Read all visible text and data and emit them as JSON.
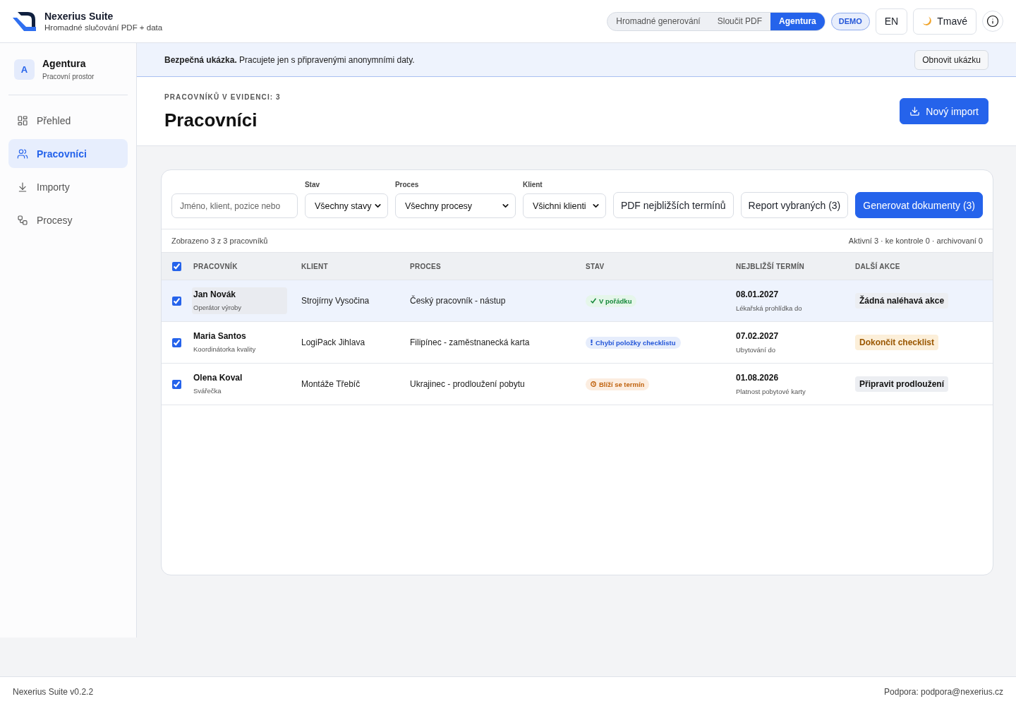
{
  "header": {
    "app_name": "Nexerius Suite",
    "tagline": "Hromadné slučování PDF + data",
    "modes": [
      {
        "label": "Hromadné generování",
        "selected": false
      },
      {
        "label": "Sloučit PDF",
        "selected": false
      },
      {
        "label": "Agentura",
        "selected": true
      }
    ],
    "badge": "DEMO",
    "language_button": "EN",
    "theme_button": "Tmavé"
  },
  "sidebar": {
    "workspace": {
      "initial": "A",
      "name": "Agentura",
      "subtitle": "Pracovní prostor"
    },
    "items": [
      {
        "label": "Přehled",
        "selected": false
      },
      {
        "label": "Pracovníci",
        "selected": true
      },
      {
        "label": "Importy",
        "selected": false
      },
      {
        "label": "Procesy",
        "selected": false
      }
    ]
  },
  "banner": {
    "text": "**Bezpečná ukázka.** Pracujete jen s připravenými anonymními daty.",
    "button": "Obnovit ukázku"
  },
  "page": {
    "eyebrow": "PRACOVNÍKŮ V EVIDENCI: 3",
    "title": "Pracovníci",
    "primary_button": "Nový import"
  },
  "filters": {
    "search": {
      "placeholder": "Jméno, klient, pozice nebo"
    },
    "selects": [
      {
        "label": "Stav",
        "value": "Všechny stavy"
      },
      {
        "label": "Proces",
        "value": "Všechny procesy"
      },
      {
        "label": "Klient",
        "value": "Všichni klienti"
      }
    ],
    "buttons": [
      {
        "label": "PDF nejbližších termínů",
        "kind": "secondary"
      },
      {
        "label": "Report vybraných (3)",
        "kind": "secondary"
      },
      {
        "label": "Generovat dokumenty (3)",
        "kind": "primary"
      }
    ]
  },
  "summary": {
    "shown": "Zobrazeno 3 z 3 pracovníků",
    "counts": "Aktivní 3 · ke kontrole 0 · archivovaní 0"
  },
  "table": {
    "select_all_checked": true,
    "columns": [
      "PRACOVNÍK",
      "KLIENT",
      "PROCES",
      "STAV",
      "NEJBLIŽŠÍ TERMÍN",
      "DALŠÍ AKCE"
    ],
    "rows": [
      {
        "checked": true,
        "highlighted": true,
        "name": "Jan Novák",
        "role": "Operátor výroby",
        "client": "Strojírny Vysočina",
        "process": "Český pracovník - nástup",
        "status": {
          "kind": "ok",
          "label": "V pořádku"
        },
        "deadline": {
          "date": "08.01.2027",
          "note": "Lékařská prohlídka do"
        },
        "action": {
          "kind": "neutral",
          "label": "Žádná naléhavá akce"
        }
      },
      {
        "checked": true,
        "highlighted": false,
        "name": "Maria Santos",
        "role": "Koordinátorka kvality",
        "client": "LogiPack Jihlava",
        "process": "Filipínec - zaměstnanecká karta",
        "status": {
          "kind": "missing",
          "label": "Chybí položky checklistu"
        },
        "deadline": {
          "date": "07.02.2027",
          "note": "Ubytování do"
        },
        "action": {
          "kind": "warning",
          "label": "Dokončit checklist"
        }
      },
      {
        "checked": true,
        "highlighted": false,
        "name": "Olena Koval",
        "role": "Svářečka",
        "client": "Montáže Třebíč",
        "process": "Ukrajinec - prodloužení pobytu",
        "status": {
          "kind": "due",
          "label": "Blíží se termín"
        },
        "deadline": {
          "date": "01.08.2026",
          "note": "Platnost pobytové karty"
        },
        "action": {
          "kind": "neutral",
          "label": "Připravit prodloužení"
        }
      }
    ]
  },
  "footer": {
    "version": "Nexerius Suite v0.2.2",
    "support": "Podpora: podpora@nexerius.cz"
  }
}
